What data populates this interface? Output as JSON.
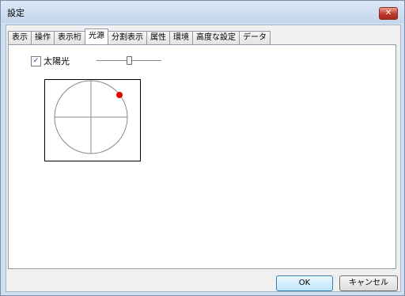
{
  "window": {
    "title": "設定",
    "close_glyph": "✕"
  },
  "tabs": [
    {
      "label": "表示",
      "active": false
    },
    {
      "label": "操作",
      "active": false
    },
    {
      "label": "表示桁",
      "active": false
    },
    {
      "label": "光源",
      "active": true
    },
    {
      "label": "分割表示",
      "active": false
    },
    {
      "label": "属性",
      "active": false
    },
    {
      "label": "環境",
      "active": false
    },
    {
      "label": "高度な設定",
      "active": false
    },
    {
      "label": "データ",
      "active": false
    }
  ],
  "light_panel": {
    "sunlight_label": "太陽光",
    "sunlight_checked": true,
    "check_glyph": "✓",
    "sun_color": "#e00000",
    "slider_level": 0.5
  },
  "buttons": {
    "ok_label": "OK",
    "cancel_label": "キャンセル"
  }
}
